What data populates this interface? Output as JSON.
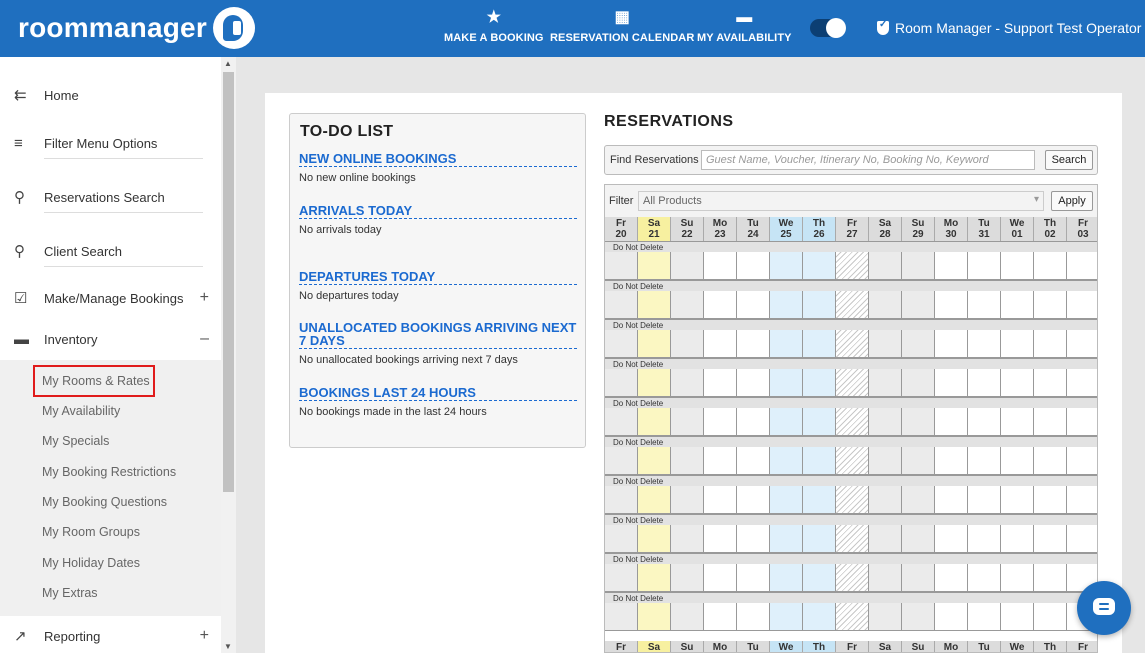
{
  "header": {
    "logo": "roommanager",
    "nav": [
      {
        "label": "MAKE A BOOKING",
        "icon": "star-icon"
      },
      {
        "label": "RESERVATION CALENDAR",
        "icon": "calendar-icon"
      },
      {
        "label": "MY AVAILABILITY",
        "icon": "bed-icon"
      }
    ],
    "user": "Room Manager - Support Test Operator"
  },
  "sidebar": {
    "items": [
      {
        "label": "Home",
        "icon": "arrow-left-menu-icon"
      },
      {
        "label": "Filter Menu Options",
        "icon": "filter-icon"
      },
      {
        "label": "Reservations Search",
        "icon": "search-icon"
      },
      {
        "label": "Client Search",
        "icon": "search-icon"
      },
      {
        "label": "Make/Manage Bookings",
        "icon": "calendar-check-icon",
        "toggle": "+"
      },
      {
        "label": "Inventory",
        "icon": "bed-icon",
        "toggle": "–"
      },
      {
        "label": "Reporting",
        "icon": "trending-up-icon",
        "toggle": "+"
      }
    ],
    "inventory_sub": [
      "My Rooms & Rates",
      "My Availability",
      "My Specials",
      "My Booking Restrictions",
      "My Booking Questions",
      "My Room Groups",
      "My Holiday Dates",
      "My Extras"
    ]
  },
  "todo": {
    "title": "TO-DO LIST",
    "sections": [
      {
        "heading": "NEW ONLINE BOOKINGS",
        "text": "No new online bookings"
      },
      {
        "heading": "ARRIVALS TODAY",
        "text": "No arrivals today"
      },
      {
        "heading": "DEPARTURES TODAY",
        "text": "No departures today"
      },
      {
        "heading": "UNALLOCATED BOOKINGS ARRIVING NEXT 7 DAYS",
        "text": "No unallocated bookings arriving next 7 days"
      },
      {
        "heading": "BOOKINGS LAST 24 HOURS",
        "text": "No bookings made in the last 24 hours"
      }
    ]
  },
  "reservations": {
    "title": "RESERVATIONS",
    "find_label": "Find Reservations",
    "find_placeholder": "Guest Name, Voucher, Itinerary No, Booking No, Keyword",
    "search_button": "Search",
    "filter_label": "Filter",
    "filter_value": "All Products",
    "apply_button": "Apply",
    "row_label": "Do Not Delete",
    "days": [
      {
        "dow": "Fr",
        "d": "20",
        "type": "past"
      },
      {
        "dow": "Sa",
        "d": "21",
        "type": "today"
      },
      {
        "dow": "Su",
        "d": "22",
        "type": "weekend"
      },
      {
        "dow": "Mo",
        "d": "23",
        "type": "normal"
      },
      {
        "dow": "Tu",
        "d": "24",
        "type": "normal"
      },
      {
        "dow": "We",
        "d": "25",
        "type": "holiday"
      },
      {
        "dow": "Th",
        "d": "26",
        "type": "holiday"
      },
      {
        "dow": "Fr",
        "d": "27",
        "type": "closed"
      },
      {
        "dow": "Sa",
        "d": "28",
        "type": "weekend"
      },
      {
        "dow": "Su",
        "d": "29",
        "type": "weekend"
      },
      {
        "dow": "Mo",
        "d": "30",
        "type": "normal"
      },
      {
        "dow": "Tu",
        "d": "31",
        "type": "normal"
      },
      {
        "dow": "We",
        "d": "01",
        "type": "normal"
      },
      {
        "dow": "Th",
        "d": "02",
        "type": "normal"
      },
      {
        "dow": "Fr",
        "d": "03",
        "type": "normal"
      }
    ],
    "row_count": 10
  },
  "colors": {
    "brand": "#1f6fbf",
    "today": "#fbf7c2",
    "holiday": "#dff0fb",
    "weekend": "#ebebeb",
    "header_today": "#f7f0a0",
    "header_holiday": "#c6e4f5",
    "header_normal": "#dcdcdc"
  }
}
